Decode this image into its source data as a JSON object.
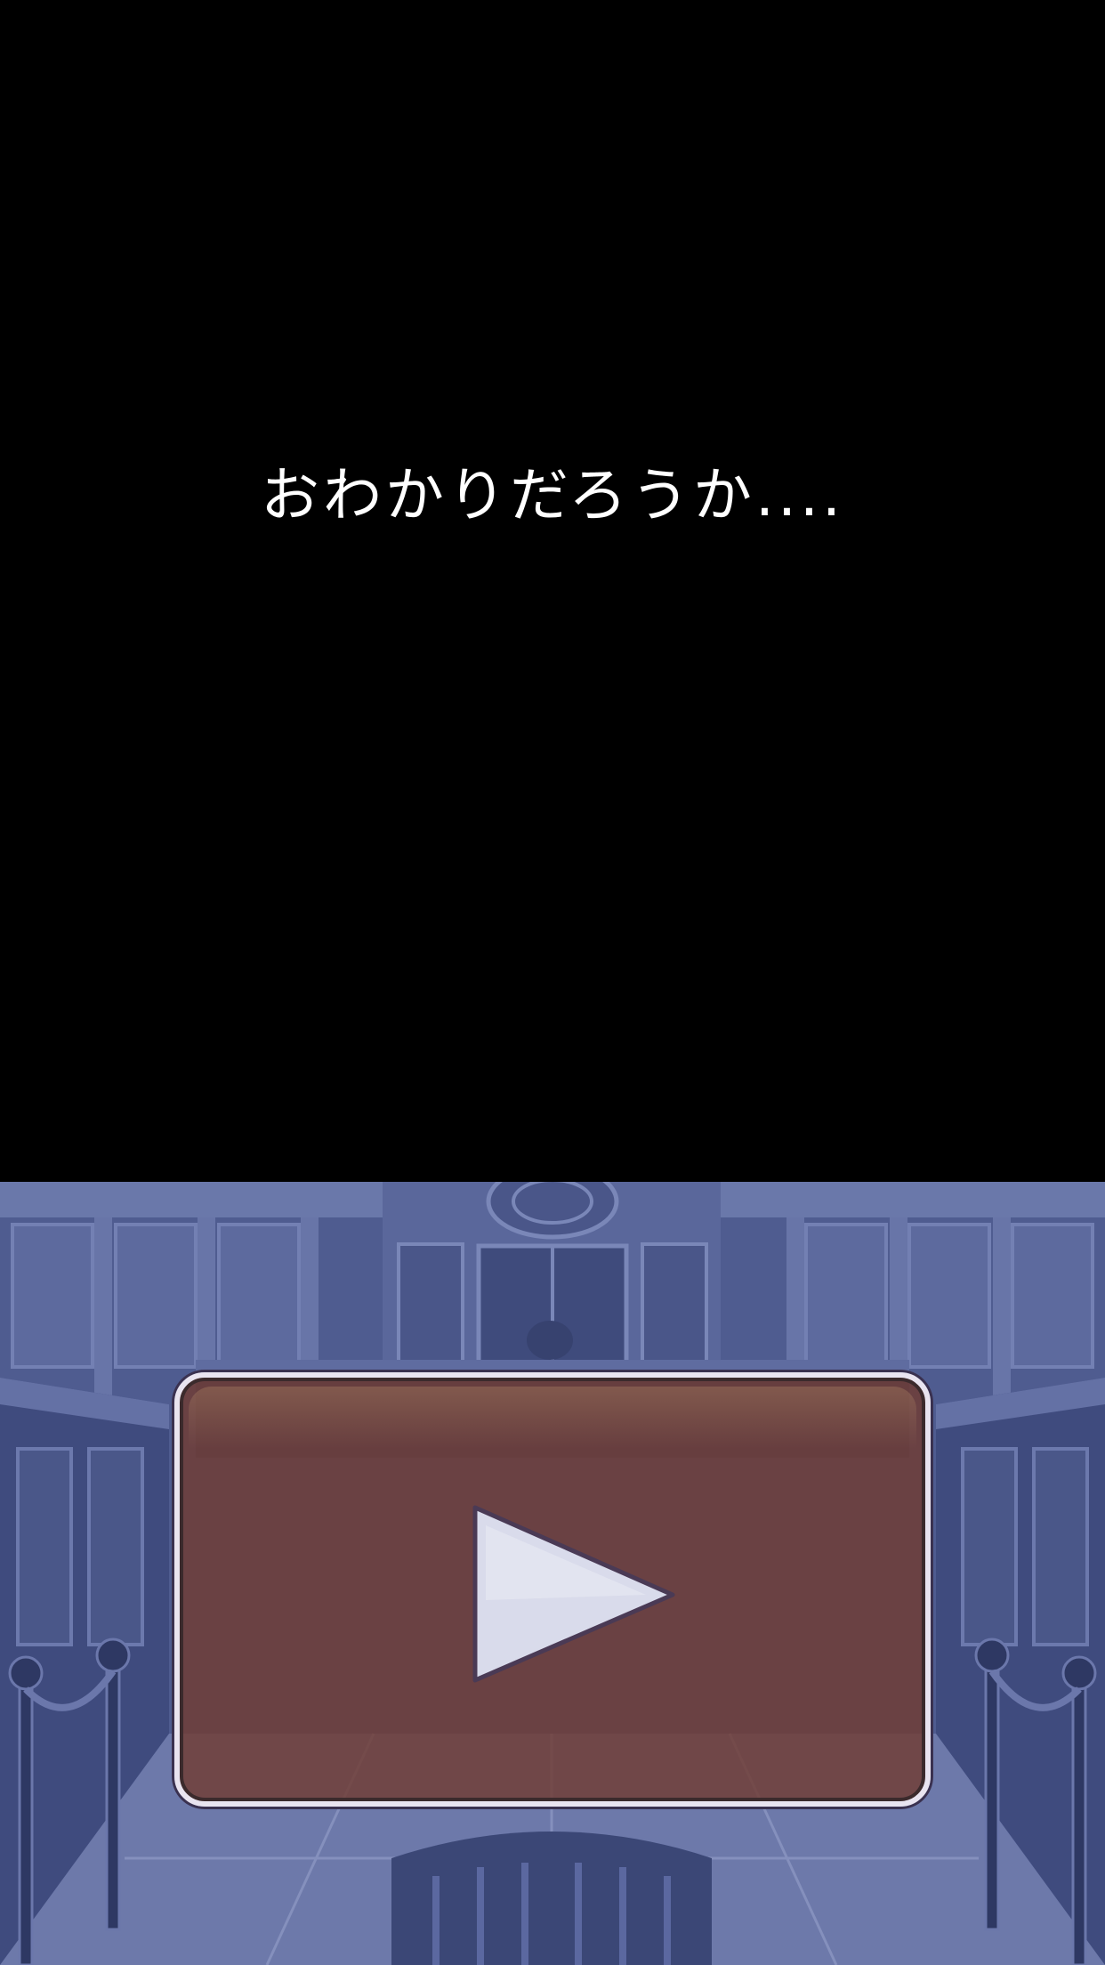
{
  "dialogue": {
    "text": "おわかりだろうか...."
  },
  "scene": {
    "background_name": "courtroom-background",
    "tint_color": "#4d5a8e"
  },
  "play_button": {
    "icon": "play-icon",
    "fill_color": "#703c32",
    "border_color": "#e9e4f0",
    "icon_color": "#d9dbeb"
  }
}
